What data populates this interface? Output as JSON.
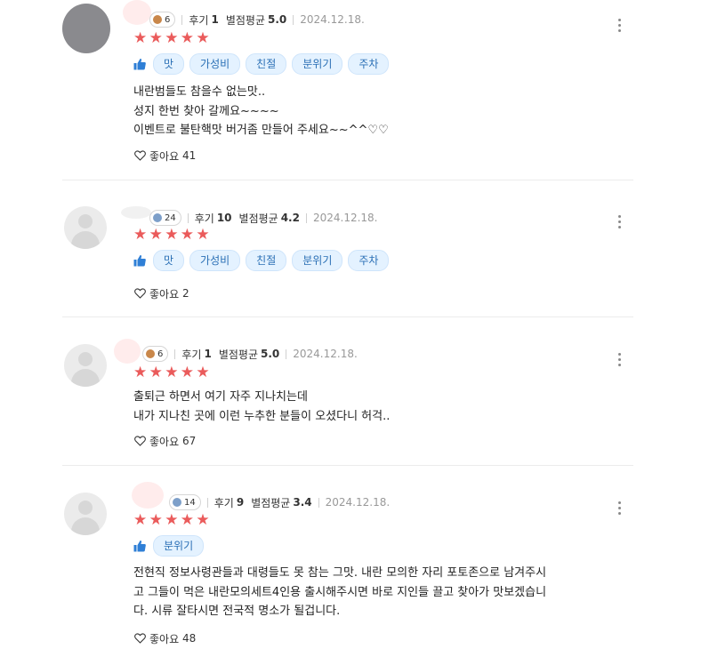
{
  "colors": {
    "star": "#ea5b5b",
    "tag_bg": "#e4f2ff",
    "tag_text": "#2a6fb5",
    "like_icon": "thumbs-up"
  },
  "reviews": [
    {
      "badge_count": "6",
      "reviews_label": "후기",
      "reviews_count": "1",
      "avg_label": "별점평균",
      "avg_value": "5.0",
      "date": "2024.12.18.",
      "tags": [
        "맛",
        "가성비",
        "친절",
        "분위기",
        "주차"
      ],
      "text": "내란범들도 참을수 없는맛..\n성지 한번 찾아 갈께요~~~~\n이벤트로 불탄핵맛 버거좀 만들어 주세요~~^^♡♡",
      "like_label": "좋아요",
      "like_count": "41"
    },
    {
      "badge_count": "24",
      "reviews_label": "후기",
      "reviews_count": "10",
      "avg_label": "별점평균",
      "avg_value": "4.2",
      "date": "2024.12.18.",
      "tags": [
        "맛",
        "가성비",
        "친절",
        "분위기",
        "주차"
      ],
      "text": "",
      "like_label": "좋아요",
      "like_count": "2"
    },
    {
      "badge_count": "6",
      "reviews_label": "후기",
      "reviews_count": "1",
      "avg_label": "별점평균",
      "avg_value": "5.0",
      "date": "2024.12.18.",
      "tags": [],
      "text": "출퇴근 하면서 여기 자주 지나치는데\n내가 지나친 곳에 이런 누추한 분들이 오셨다니 허걱..",
      "like_label": "좋아요",
      "like_count": "67"
    },
    {
      "badge_count": "14",
      "reviews_label": "후기",
      "reviews_count": "9",
      "avg_label": "별점평균",
      "avg_value": "3.4",
      "date": "2024.12.18.",
      "tags": [
        "분위기"
      ],
      "text": "전현직 정보사령관들과 대령들도 못 참는 그맛.  내란 모의한 자리 포토존으로 남겨주시\n고 그들이 먹은 내란모의세트4인용 출시해주시면 바로 지인들 끌고 찾아가 맛보겠습니\n다.  시류 잘타시면 전국적 명소가 될겁니다.",
      "like_label": "좋아요",
      "like_count": "48"
    }
  ]
}
